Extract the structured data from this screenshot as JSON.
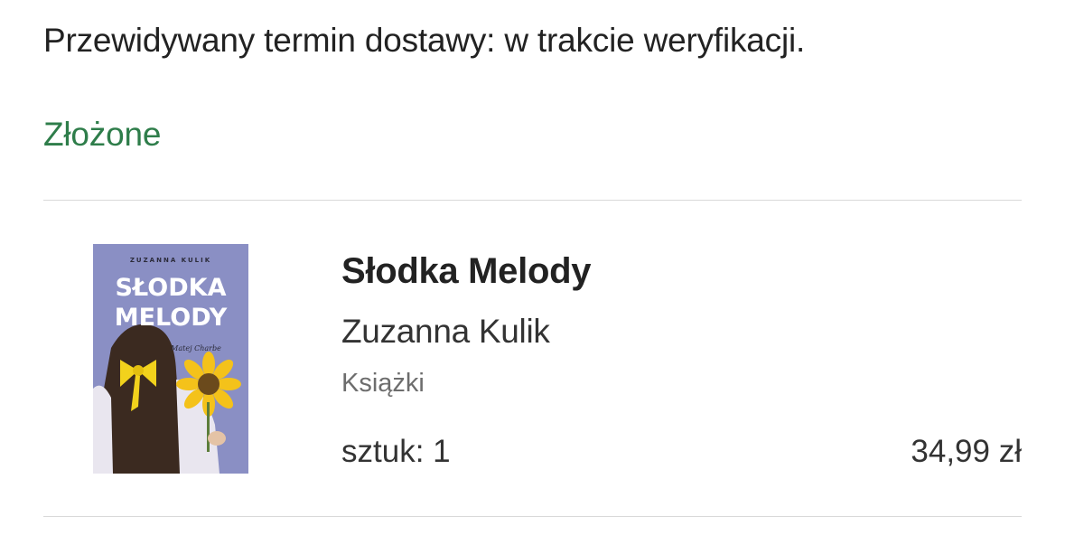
{
  "order": {
    "delivery_text": "Przewidywany termin dostawy: w trakcie weryfikacji.",
    "status": "Złożone",
    "status_color": "#2e7d4a"
  },
  "item": {
    "cover": {
      "author_text": "ZUZANNA KULIK",
      "title_line1": "SŁODKA",
      "title_line2": "MELODY",
      "subtitle": "Matej Charbe",
      "background_color": "#8a8fc4"
    },
    "title": "Słodka Melody",
    "author": "Zuzanna Kulik",
    "category": "Książki",
    "quantity": "sztuk: 1",
    "price": "34,99 zł"
  }
}
